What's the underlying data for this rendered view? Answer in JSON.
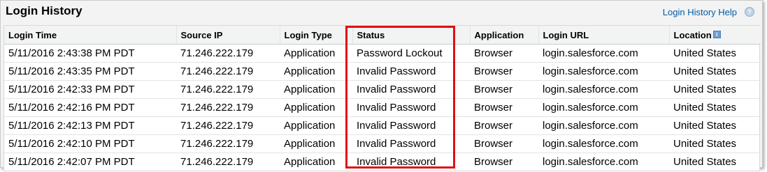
{
  "header": {
    "title": "Login History",
    "help_link": "Login History Help",
    "help_icon_glyph": "?"
  },
  "table": {
    "columns": [
      "Login Time",
      "Source IP",
      "Login Type",
      "Status",
      "Application",
      "Login URL",
      "Location"
    ],
    "location_info_icon": "i",
    "rows": [
      [
        "5/11/2016 2:43:38 PM PDT",
        "71.246.222.179",
        "Application",
        "Password Lockout",
        "Browser",
        "login.salesforce.com",
        "United States"
      ],
      [
        "5/11/2016 2:43:35 PM PDT",
        "71.246.222.179",
        "Application",
        "Invalid Password",
        "Browser",
        "login.salesforce.com",
        "United States"
      ],
      [
        "5/11/2016 2:42:33 PM PDT",
        "71.246.222.179",
        "Application",
        "Invalid Password",
        "Browser",
        "login.salesforce.com",
        "United States"
      ],
      [
        "5/11/2016 2:42:16 PM PDT",
        "71.246.222.179",
        "Application",
        "Invalid Password",
        "Browser",
        "login.salesforce.com",
        "United States"
      ],
      [
        "5/11/2016 2:42:13 PM PDT",
        "71.246.222.179",
        "Application",
        "Invalid Password",
        "Browser",
        "login.salesforce.com",
        "United States"
      ],
      [
        "5/11/2016 2:42:10 PM PDT",
        "71.246.222.179",
        "Application",
        "Invalid Password",
        "Browser",
        "login.salesforce.com",
        "United States"
      ],
      [
        "5/11/2016 2:42:07 PM PDT",
        "71.246.222.179",
        "Application",
        "Invalid Password",
        "Browser",
        "login.salesforce.com",
        "United States"
      ]
    ]
  },
  "colors": {
    "link": "#015ba7",
    "highlight": "#e01010",
    "header_bg": "#f2f3f3"
  }
}
